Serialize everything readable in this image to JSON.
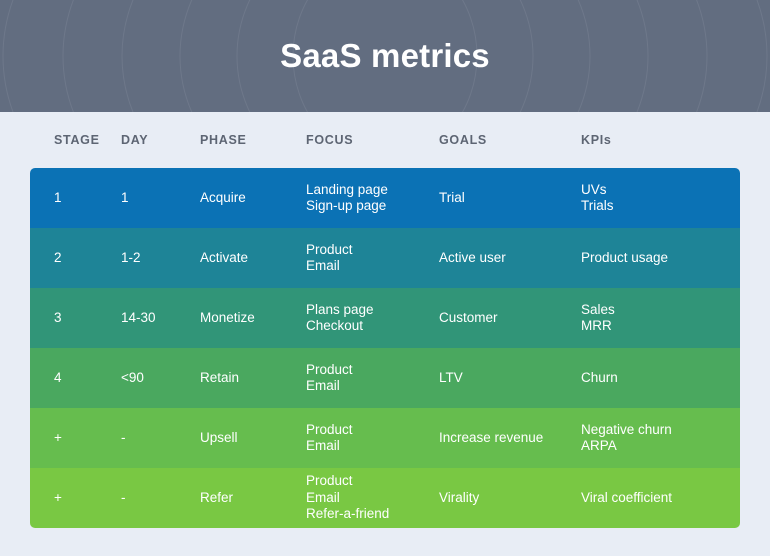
{
  "banner": {
    "title": "SaaS metrics",
    "background_color": "#626d80",
    "title_color": "#ffffff"
  },
  "page": {
    "background_color": "#e8edf5"
  },
  "table": {
    "columns": [
      {
        "key": "stage",
        "label": "STAGE"
      },
      {
        "key": "day",
        "label": "DAY"
      },
      {
        "key": "phase",
        "label": "PHASE"
      },
      {
        "key": "focus",
        "label": "FOCUS"
      },
      {
        "key": "goals",
        "label": "GOALS"
      },
      {
        "key": "kpis",
        "label": "KPIs"
      }
    ],
    "header_text_color": "#5d6573",
    "rows": [
      {
        "stage": "1",
        "day": "1",
        "phase": "Acquire",
        "focus": "Landing page\nSign-up page",
        "goals": "Trial",
        "kpis": "UVs\nTrials",
        "color": "#0b72b5"
      },
      {
        "stage": "2",
        "day": "1-2",
        "phase": "Activate",
        "focus": "Product\nEmail",
        "goals": "Active user",
        "kpis": "Product usage",
        "color": "#1e8497"
      },
      {
        "stage": "3",
        "day": "14-30",
        "phase": "Monetize",
        "focus": "Plans page\nCheckout",
        "goals": "Customer",
        "kpis": "Sales\nMRR",
        "color": "#319578"
      },
      {
        "stage": "4",
        "day": "<90",
        "phase": "Retain",
        "focus": "Product\nEmail",
        "goals": "LTV",
        "kpis": "Churn",
        "color": "#4aa85f"
      },
      {
        "stage": "+",
        "day": "-",
        "phase": "Upsell",
        "focus": "Product\nEmail",
        "goals": "Increase revenue",
        "kpis": "Negative churn\nARPA",
        "color": "#66bd4e"
      },
      {
        "stage": "+",
        "day": "-",
        "phase": "Refer",
        "focus": "Product\nEmail\nRefer-a-friend",
        "goals": "Virality",
        "kpis": "Viral coefficient",
        "color": "#79c843"
      }
    ]
  }
}
